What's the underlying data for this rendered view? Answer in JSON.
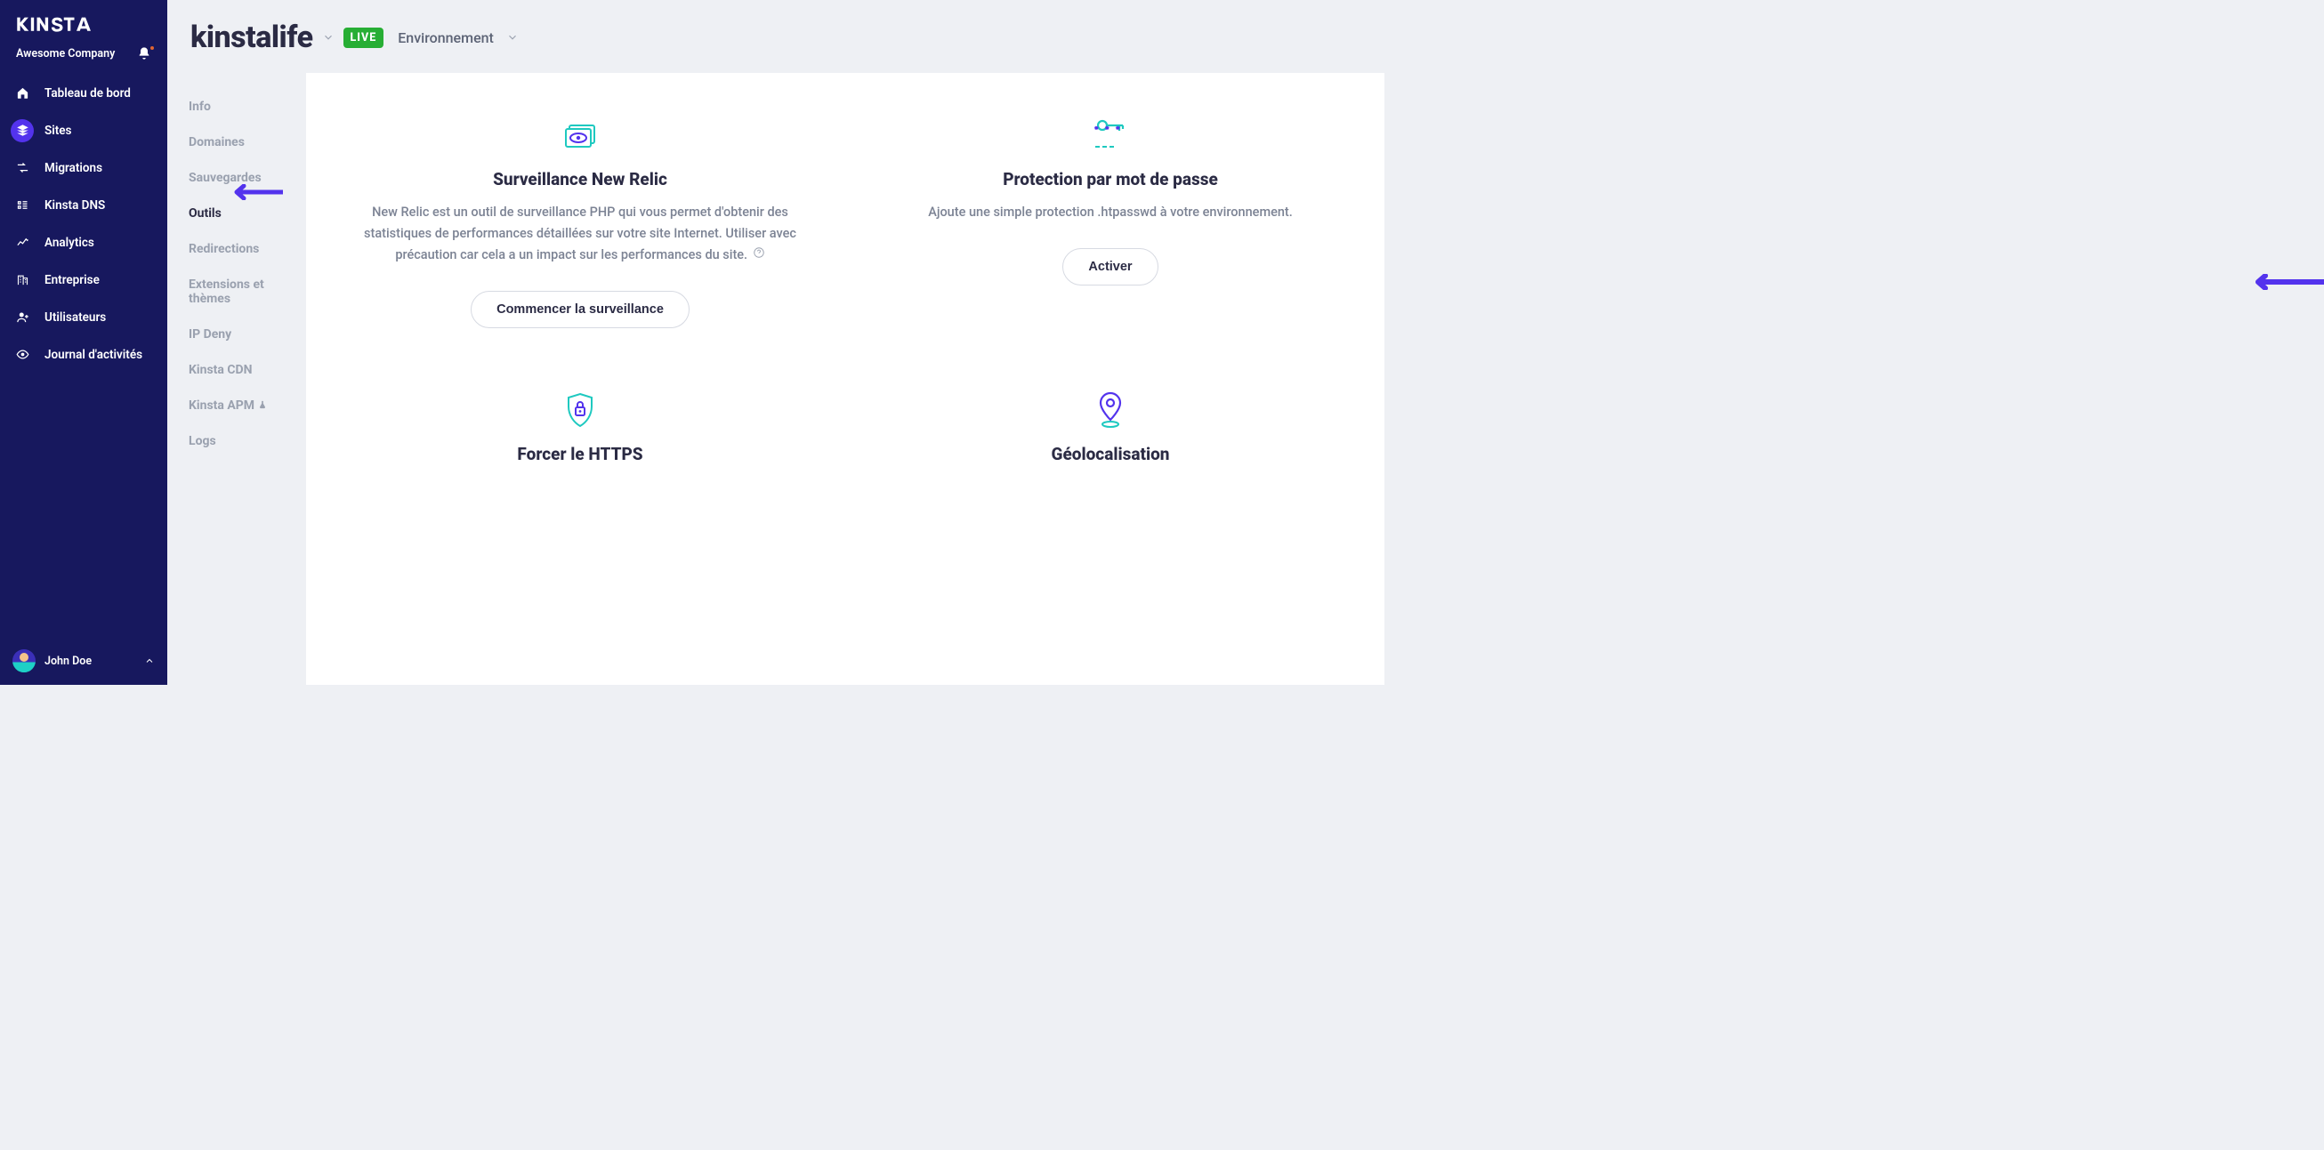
{
  "brand": "Kinsta",
  "company": "Awesome Company",
  "user": "John Doe",
  "nav": [
    {
      "label": "Tableau de bord",
      "icon": "home"
    },
    {
      "label": "Sites",
      "icon": "stack",
      "active": true
    },
    {
      "label": "Migrations",
      "icon": "migr"
    },
    {
      "label": "Kinsta DNS",
      "icon": "dns"
    },
    {
      "label": "Analytics",
      "icon": "chart"
    },
    {
      "label": "Entreprise",
      "icon": "building"
    },
    {
      "label": "Utilisateurs",
      "icon": "user-add"
    },
    {
      "label": "Journal d'activités",
      "icon": "eye"
    }
  ],
  "site": {
    "title": "kinstalife",
    "badge": "LIVE",
    "env_label": "Environnement"
  },
  "subnav": [
    {
      "label": "Info"
    },
    {
      "label": "Domaines"
    },
    {
      "label": "Sauvegardes"
    },
    {
      "label": "Outils",
      "active": true
    },
    {
      "label": "Redirections"
    },
    {
      "label": "Extensions et thèmes"
    },
    {
      "label": "IP Deny"
    },
    {
      "label": "Kinsta CDN"
    },
    {
      "label": "Kinsta APM",
      "chip": true
    },
    {
      "label": "Logs"
    }
  ],
  "cards": {
    "newrelic": {
      "title": "Surveillance New Relic",
      "desc": "New Relic est un outil de surveillance PHP qui vous permet d'obtenir des statistiques de performances détaillées sur votre site Internet. Utiliser avec précaution car cela a un impact sur les performances du site.",
      "button": "Commencer la surveillance"
    },
    "password": {
      "title": "Protection par mot de passe",
      "desc": "Ajoute une simple protection .htpasswd à votre environnement.",
      "button": "Activer"
    },
    "https": {
      "title": "Forcer le HTTPS"
    },
    "geo": {
      "title": "Géolocalisation"
    }
  }
}
